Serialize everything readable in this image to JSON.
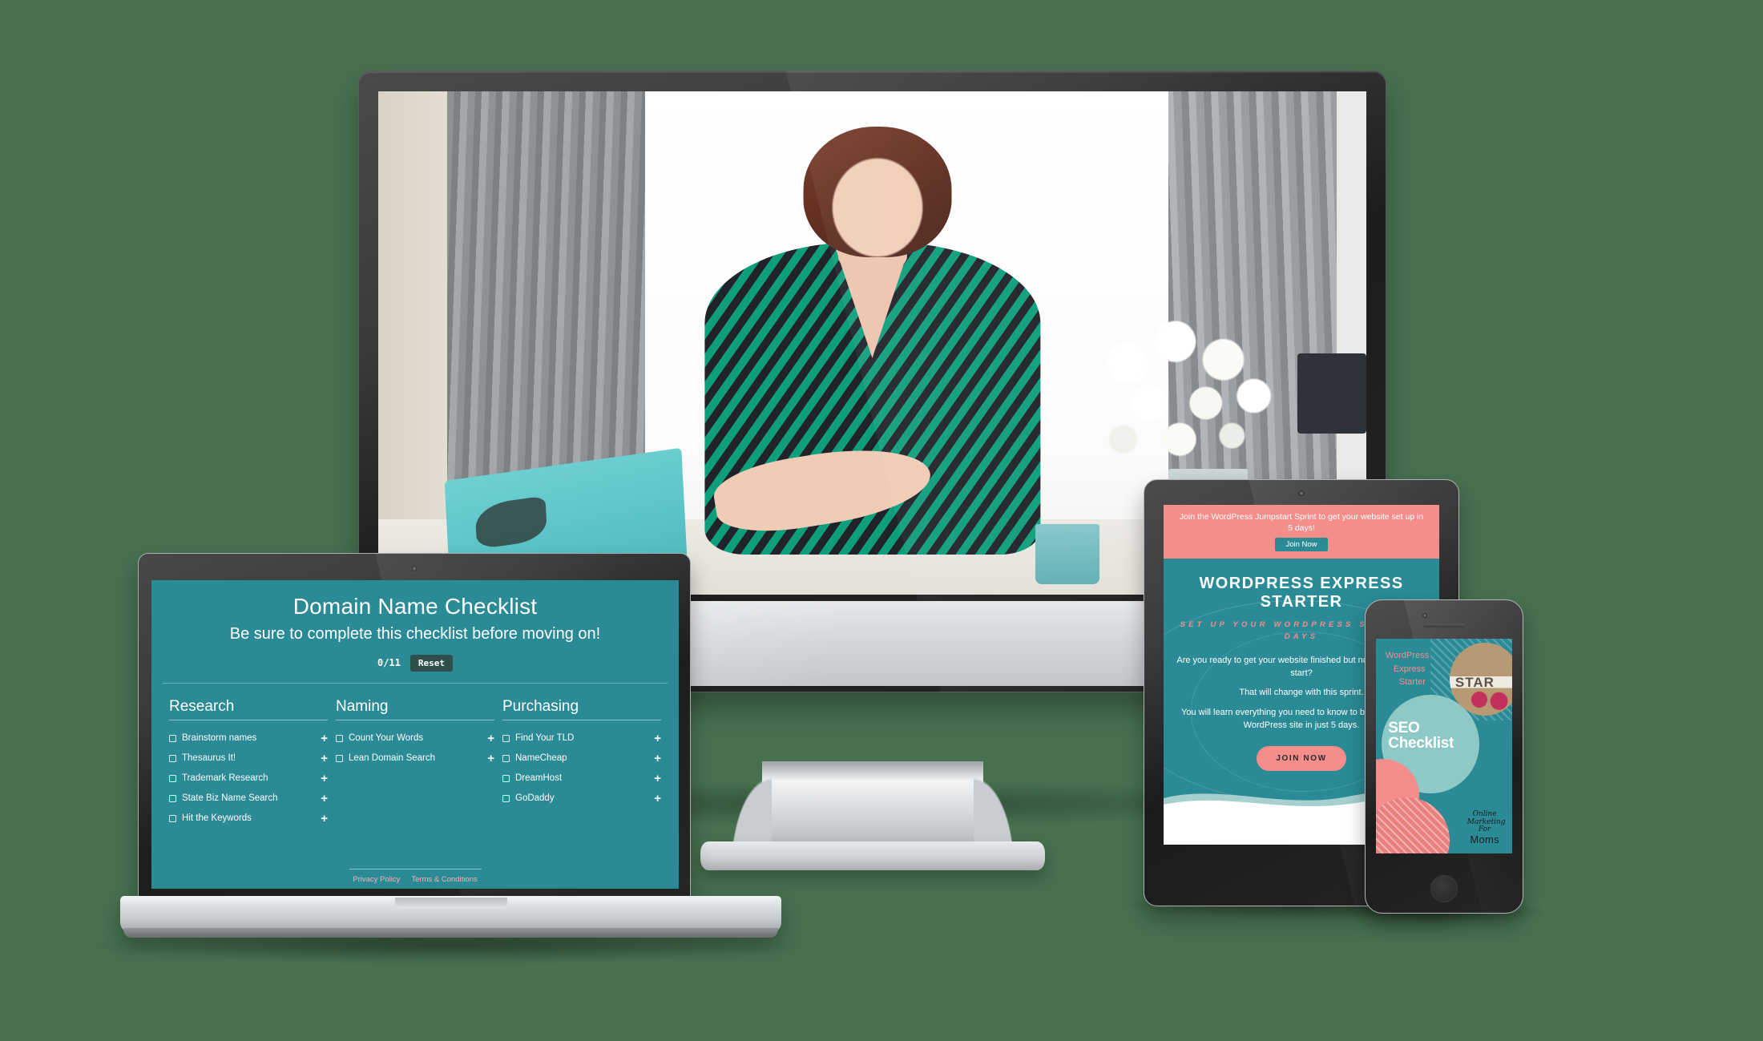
{
  "background_color": "#47704f",
  "brand_colors": {
    "teal": "#2a8a96",
    "coral": "#f58e8b",
    "light_teal": "#8fc9c6",
    "dark_button": "#2f4f4a"
  },
  "desktop": {
    "device": "desktop-monitor",
    "photo_alt": "Woman in green chevron dress working at a white desk near a window with grey curtains, white flowers in a vase, teal laptop and patterned notebook"
  },
  "laptop": {
    "device": "laptop",
    "app": {
      "title": "Domain Name Checklist",
      "subtitle": "Be sure to complete this checklist before moving on!",
      "counter": "0/11",
      "reset_label": "Reset",
      "columns": [
        {
          "heading": "Research",
          "items": [
            {
              "label": "Brainstorm names",
              "expand": "+"
            },
            {
              "label": "Thesaurus It!",
              "expand": "+"
            },
            {
              "label": "Trademark Research",
              "expand": "+"
            },
            {
              "label": "State Biz Name Search",
              "expand": "+"
            },
            {
              "label": "Hit the Keywords",
              "expand": "+"
            }
          ]
        },
        {
          "heading": "Naming",
          "items": [
            {
              "label": "Count Your Words",
              "expand": "+"
            },
            {
              "label": "Lean Domain Search",
              "expand": "+"
            }
          ]
        },
        {
          "heading": "Purchasing",
          "items": [
            {
              "label": "Find Your TLD",
              "expand": "+"
            },
            {
              "label": "NameCheap",
              "expand": "+"
            },
            {
              "label": "DreamHost",
              "expand": "+"
            },
            {
              "label": "GoDaddy",
              "expand": "+"
            }
          ]
        }
      ],
      "footer_links": [
        "Privacy Policy",
        "Terms & Conditions"
      ]
    }
  },
  "tablet": {
    "device": "tablet",
    "banner": {
      "text": "Join the WordPress Jumpstart Sprint to get your website set up in 5 days!",
      "button_label": "Join Now"
    },
    "hero": {
      "headline": "WORDPRESS EXPRESS STARTER",
      "subheadline": "SET UP YOUR WORDPRESS SITE IN 5 DAYS",
      "paragraph_1": "Are you ready to get your website finished but not sure where to start?",
      "paragraph_2": "That will change with this sprint.",
      "paragraph_3": "You will learn everything you need to know to build a beautiful WordPress site in just 5 days.",
      "cta_label": "JOIN NOW"
    }
  },
  "phone": {
    "device": "phone",
    "cover": {
      "brand_line_1": "WordPress",
      "brand_line_2": "Express",
      "brand_line_3": "Starter",
      "title_line_1": "SEO",
      "title_line_2": "Checklist",
      "photo_word": "STAR",
      "logo_line_1": "Online",
      "logo_line_2": "Marketing",
      "logo_line_3": "For",
      "logo_line_4": "Moms"
    }
  }
}
